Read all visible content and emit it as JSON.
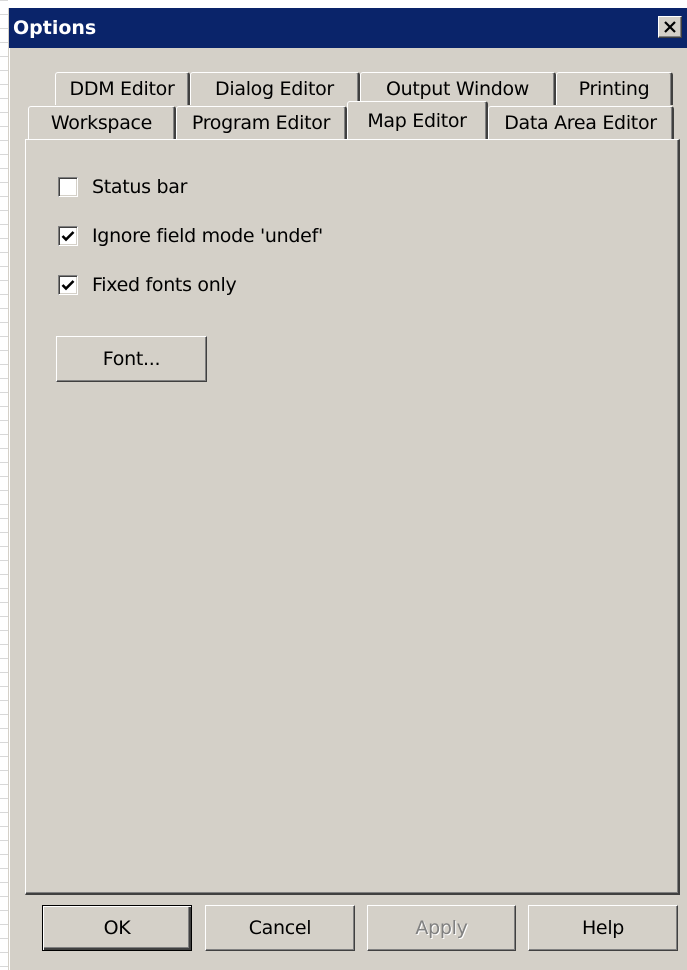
{
  "window": {
    "title": "Options",
    "close_glyph": "✕",
    "close_icon": "close-icon"
  },
  "tabs": {
    "row_back": [
      {
        "label": "DDM Editor"
      },
      {
        "label": "Dialog Editor"
      },
      {
        "label": "Output Window"
      },
      {
        "label": "Printing"
      }
    ],
    "row_front": [
      {
        "label": "Workspace"
      },
      {
        "label": "Program Editor"
      },
      {
        "label": "Map Editor",
        "active": true
      },
      {
        "label": "Data Area Editor"
      }
    ]
  },
  "map_editor": {
    "status_bar": {
      "label": "Status bar",
      "checked": false
    },
    "ignore_undef": {
      "label": "Ignore field mode 'undef'",
      "checked": true
    },
    "fixed_fonts": {
      "label": "Fixed fonts only",
      "checked": true
    },
    "font_button": "Font..."
  },
  "buttons": {
    "ok": "OK",
    "cancel": "Cancel",
    "apply": "Apply",
    "help": "Help"
  },
  "colors": {
    "titlebar": "#0a246a",
    "face": "#d4d0c8"
  }
}
